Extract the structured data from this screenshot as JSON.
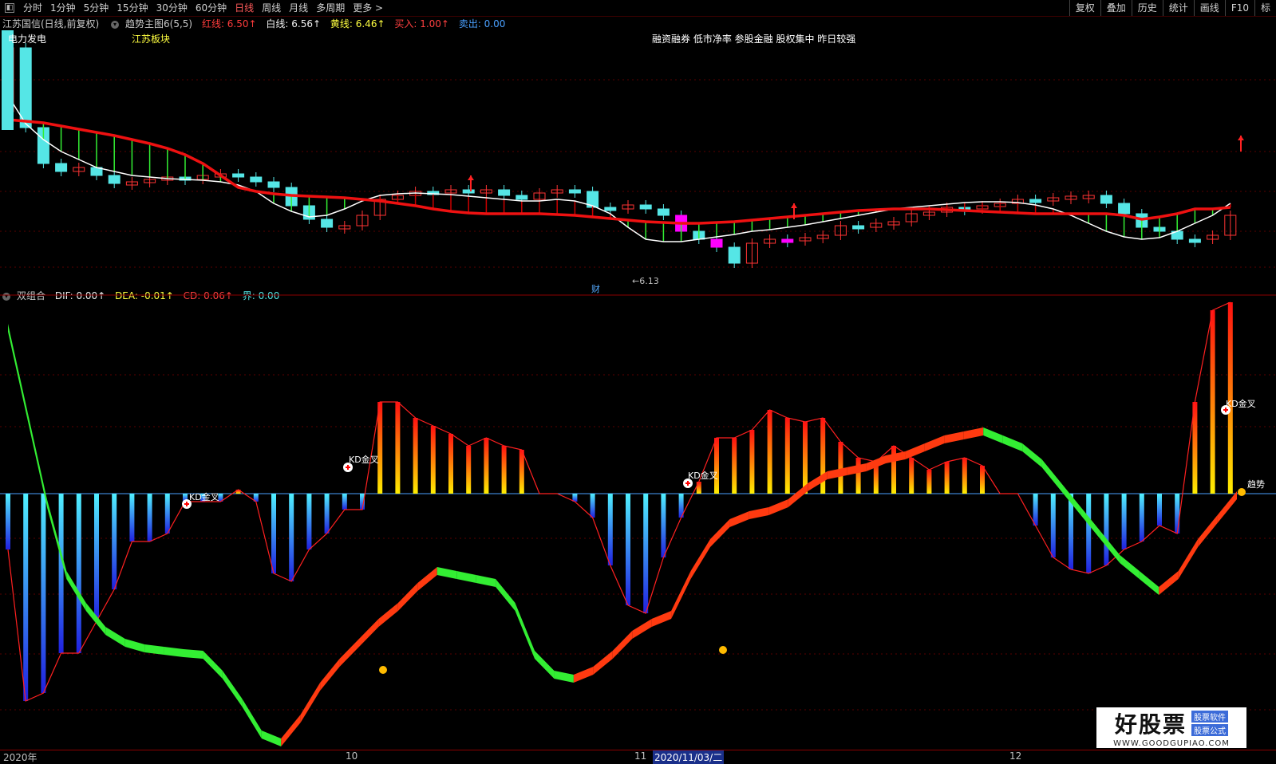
{
  "toolbar": {
    "periods": [
      "分时",
      "1分钟",
      "5分钟",
      "15分钟",
      "30分钟",
      "60分钟",
      "日线",
      "周线",
      "月线",
      "多周期",
      "更多 >"
    ],
    "active_period": "日线",
    "right_buttons": [
      "复权",
      "叠加",
      "历史",
      "统计",
      "画线",
      "F10",
      "标"
    ]
  },
  "main_legend": {
    "stock_name": "江苏国信(日线,前复权)",
    "indicator_name": "趋势主图6(5,5)",
    "red_line": "红线: 6.50↑",
    "white_line": "白线: 6.56↑",
    "yellow_line": "黄线: 6.46↑",
    "buy": "买入: 1.00↑",
    "sell": "卖出: 0.00"
  },
  "main_labels": {
    "top_left": "电力发电",
    "sector": "江苏板块",
    "tags": "融资融券 低市净率 参股金融 股权集中 昨日较强",
    "low_price": "←6.13",
    "finance_marker": "财"
  },
  "sub_legend": {
    "name": "双组合",
    "dif": "DIF: 0.00↑",
    "dea": "DEA: -0.01↑",
    "cd": "CD: 0.06↑",
    "jie": "界: 0.00"
  },
  "sub_labels": {
    "kd_cross": "KD金叉",
    "trend": "趋势"
  },
  "axis": {
    "labels": [
      "2020年",
      "10",
      "11",
      "12"
    ],
    "cursor_date": "2020/11/03/二"
  },
  "watermark": {
    "main": "好股票",
    "side1": "股票软件",
    "side2": "股票公式",
    "url": "WWW.GOODGUPIAO.COM"
  },
  "colors": {
    "up": "#ff2222",
    "down": "#55e6e6",
    "magenta": "#ff00ff",
    "green": "#33ee33",
    "red_line": "#ee1111"
  }
}
